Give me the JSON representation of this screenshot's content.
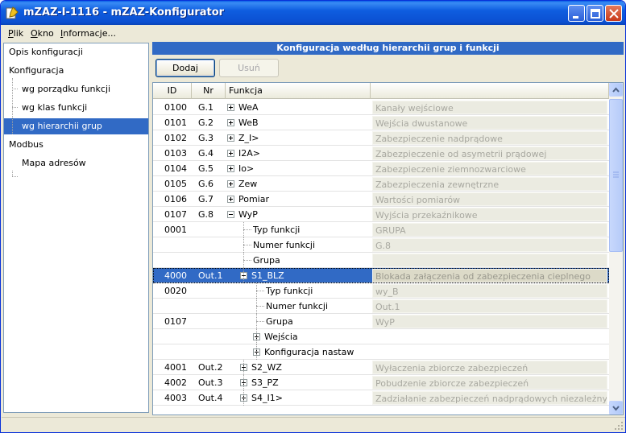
{
  "window": {
    "title": "mZAZ-I-1116 - mZAZ-Konfigurator"
  },
  "menu": {
    "items": [
      {
        "label": "Plik",
        "accel": "P",
        "rest": "lik"
      },
      {
        "label": "Okno",
        "accel": "O",
        "rest": "kno"
      },
      {
        "label": "Informacje...",
        "accel": "I",
        "rest": "nformacje..."
      }
    ]
  },
  "left_tree": {
    "items": [
      {
        "label": "Opis konfiguracji",
        "level": 0,
        "selected": false
      },
      {
        "label": "Konfiguracja",
        "level": 0,
        "selected": false
      },
      {
        "label": "wg porządku funkcji",
        "level": 1,
        "selected": false
      },
      {
        "label": "wg klas funkcji",
        "level": 1,
        "selected": false
      },
      {
        "label": "wg hierarchii grup",
        "level": 1,
        "selected": true
      },
      {
        "label": "Modbus",
        "level": 0,
        "selected": false
      },
      {
        "label": "Mapa adresów",
        "level": 1,
        "selected": false
      }
    ]
  },
  "panel": {
    "header": "Konfiguracja według hierarchii grup i funkcji",
    "add_label": "Dodaj",
    "remove_label": "Usuń"
  },
  "grid": {
    "columns": [
      "ID",
      "Nr",
      "Funkcja",
      ""
    ],
    "rows": [
      {
        "id": "0100",
        "nr": "G.1",
        "fn": "WeA",
        "desc": "Kanały wejściowe",
        "level": 0,
        "expander": "plus"
      },
      {
        "id": "0101",
        "nr": "G.2",
        "fn": "WeB",
        "desc": "Wejścia dwustanowe",
        "level": 0,
        "expander": "plus"
      },
      {
        "id": "0102",
        "nr": "G.3",
        "fn": "Z_I>",
        "desc": "Zabezpieczenie nadprądowe",
        "level": 0,
        "expander": "plus"
      },
      {
        "id": "0103",
        "nr": "G.4",
        "fn": "I2A>",
        "desc": "Zabezpieczenie od asymetrii prądowej",
        "level": 0,
        "expander": "plus"
      },
      {
        "id": "0104",
        "nr": "G.5",
        "fn": "Io>",
        "desc": "Zabezpieczenie ziemnozwarciowe",
        "level": 0,
        "expander": "plus"
      },
      {
        "id": "0105",
        "nr": "G.6",
        "fn": "Zew",
        "desc": "Zabezpieczenia zewnętrzne",
        "level": 0,
        "expander": "plus"
      },
      {
        "id": "0106",
        "nr": "G.7",
        "fn": "Pomiar",
        "desc": "Wartości pomiarów",
        "level": 0,
        "expander": "plus"
      },
      {
        "id": "0107",
        "nr": "G.8",
        "fn": "WyP",
        "desc": "Wyjścia przekaźnikowe",
        "level": 0,
        "expander": "minus"
      },
      {
        "id": "0001",
        "nr": "",
        "fn": "Typ funkcji",
        "desc": "GRUPA",
        "level": 1,
        "expander": ""
      },
      {
        "id": "",
        "nr": "",
        "fn": "Numer funkcji",
        "desc": "G.8",
        "level": 1,
        "expander": ""
      },
      {
        "id": "",
        "nr": "",
        "fn": "Grupa",
        "desc": "",
        "level": 1,
        "expander": ""
      },
      {
        "id": "4000",
        "nr": "Out.1",
        "fn": "S1_BLZ",
        "desc": "Blokada załączenia od zabezpieczenia cieplnego",
        "level": 1,
        "expander": "minus",
        "selected": true
      },
      {
        "id": "0020",
        "nr": "",
        "fn": "Typ funkcji",
        "desc": "wy_B",
        "level": 2,
        "expander": ""
      },
      {
        "id": "",
        "nr": "",
        "fn": "Numer funkcji",
        "desc": "Out.1",
        "level": 2,
        "expander": ""
      },
      {
        "id": "0107",
        "nr": "",
        "fn": "Grupa",
        "desc": "WyP",
        "level": 2,
        "expander": ""
      },
      {
        "id": "",
        "nr": "",
        "fn": "Wejścia",
        "desc": null,
        "level": 2,
        "expander": "plus"
      },
      {
        "id": "",
        "nr": "",
        "fn": "Konfiguracja nastaw",
        "desc": null,
        "level": 2,
        "expander": "plus"
      },
      {
        "id": "4001",
        "nr": "Out.2",
        "fn": "S2_WZ",
        "desc": "Wyłaczenia zbiorcze zabezpieczeń",
        "level": 1,
        "expander": "plus"
      },
      {
        "id": "4002",
        "nr": "Out.3",
        "fn": "S3_PZ",
        "desc": "Pobudzenie zbiorcze zabezpieczeń",
        "level": 1,
        "expander": "plus"
      },
      {
        "id": "4003",
        "nr": "Out.4",
        "fn": "S4_I1>",
        "desc": "Zadziałanie zabezpieczeń nadprądowych niezależnych",
        "level": 1,
        "expander": "plus"
      }
    ]
  },
  "colors": {
    "selection": "#316ac5",
    "titlebar": "#0b4fd1"
  },
  "icons": {
    "app": "document-pencil-icon",
    "minimize": "minimize-icon",
    "maximize": "maximize-icon",
    "close": "close-icon"
  }
}
